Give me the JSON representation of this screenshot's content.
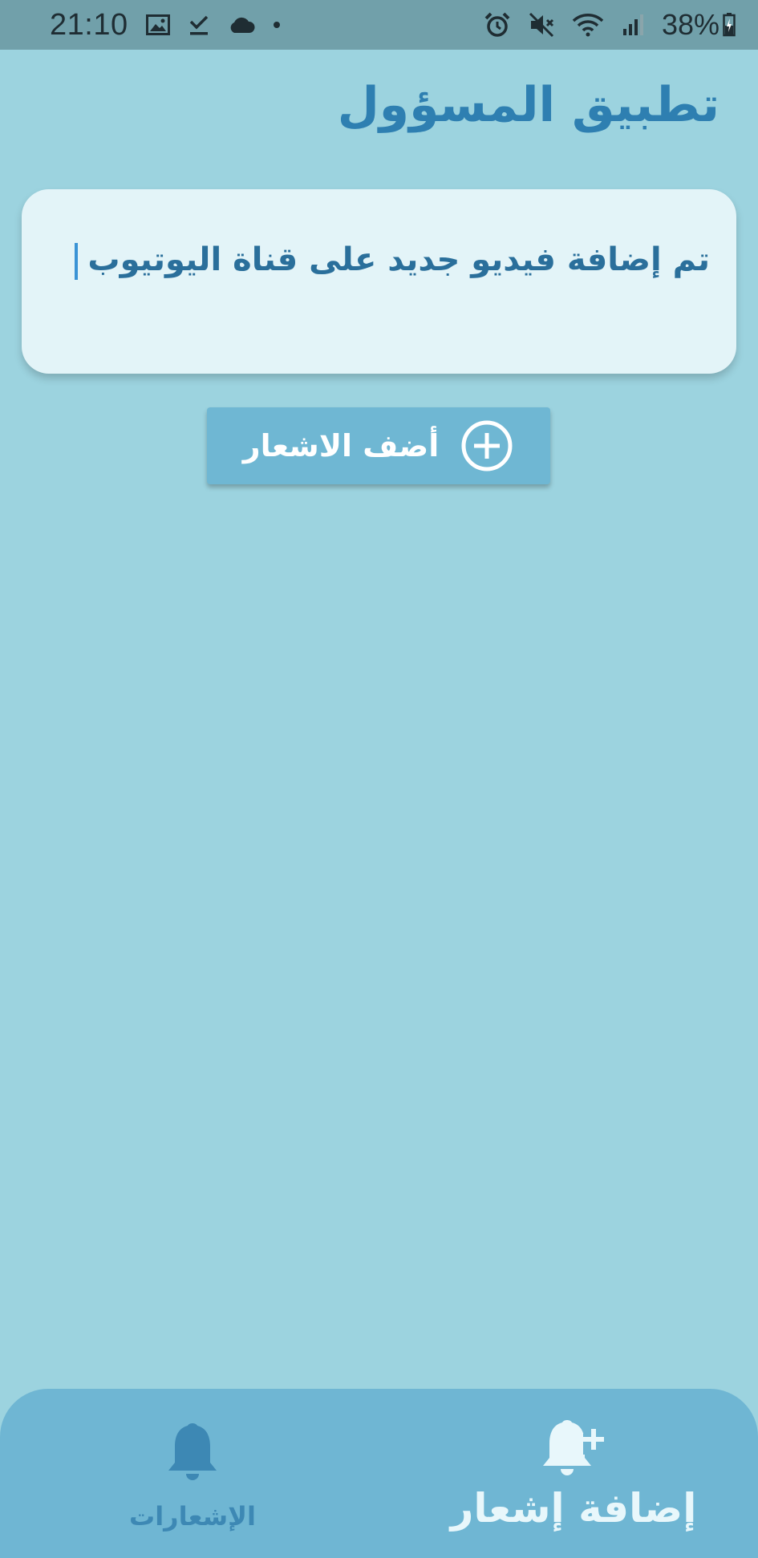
{
  "status_bar": {
    "time": "21:10",
    "battery": "38%",
    "left_icons": [
      "image-icon",
      "download-done-icon",
      "cloud-icon",
      "dot-icon"
    ],
    "right_icons": [
      "alarm-icon",
      "mute-icon",
      "wifi-icon",
      "signal-icon",
      "battery-icon"
    ]
  },
  "header": {
    "title": "تطبيق المسؤول"
  },
  "note_card": {
    "text": "تم إضافة فيديو جديد على قناة اليوتيوب"
  },
  "add_button": {
    "label": "أضف الاشعار",
    "icon": "plus-circle-icon"
  },
  "bottom_nav": {
    "items": [
      {
        "label": "إضافة إشعار",
        "icon": "bell-plus-icon",
        "active": true
      },
      {
        "label": "الإشعارات",
        "icon": "bell-icon",
        "active": false
      }
    ]
  },
  "colors": {
    "background": "#9cd3df",
    "status_bar": "#71a0aa",
    "title": "#2e7fb1",
    "card": "#e3f4f8",
    "button": "#6fb7d3",
    "nav": "#6fb6d3"
  }
}
